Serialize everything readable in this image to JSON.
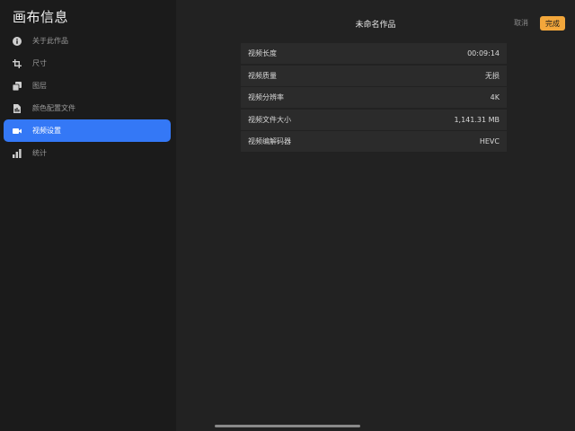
{
  "sidebar": {
    "title": "画布信息",
    "items": [
      {
        "label": "关于此作品",
        "icon": "info-icon",
        "active": false
      },
      {
        "label": "尺寸",
        "icon": "crop-icon",
        "active": false
      },
      {
        "label": "图层",
        "icon": "layers-icon",
        "active": false
      },
      {
        "label": "颜色配置文件",
        "icon": "color-profile-icon",
        "active": false
      },
      {
        "label": "视频设置",
        "icon": "video-camera-icon",
        "active": true
      },
      {
        "label": "统计",
        "icon": "bar-chart-icon",
        "active": false
      }
    ]
  },
  "header": {
    "title": "未命名作品",
    "cancel_label": "取消",
    "done_label": "完成"
  },
  "video_info": {
    "rows": [
      {
        "label": "视频长度",
        "value": "00:09:14"
      },
      {
        "label": "视频质量",
        "value": "无损"
      },
      {
        "label": "视频分辨率",
        "value": "4K"
      },
      {
        "label": "视频文件大小",
        "value": "1,141.31 MB"
      },
      {
        "label": "视频编解码器",
        "value": "HEVC"
      }
    ]
  },
  "colors": {
    "accent": "#3478f6",
    "done_button": "#f3a73b",
    "background": "#222222",
    "sidebar_background": "#1b1b1b",
    "row_background": "#2b2b2b"
  }
}
